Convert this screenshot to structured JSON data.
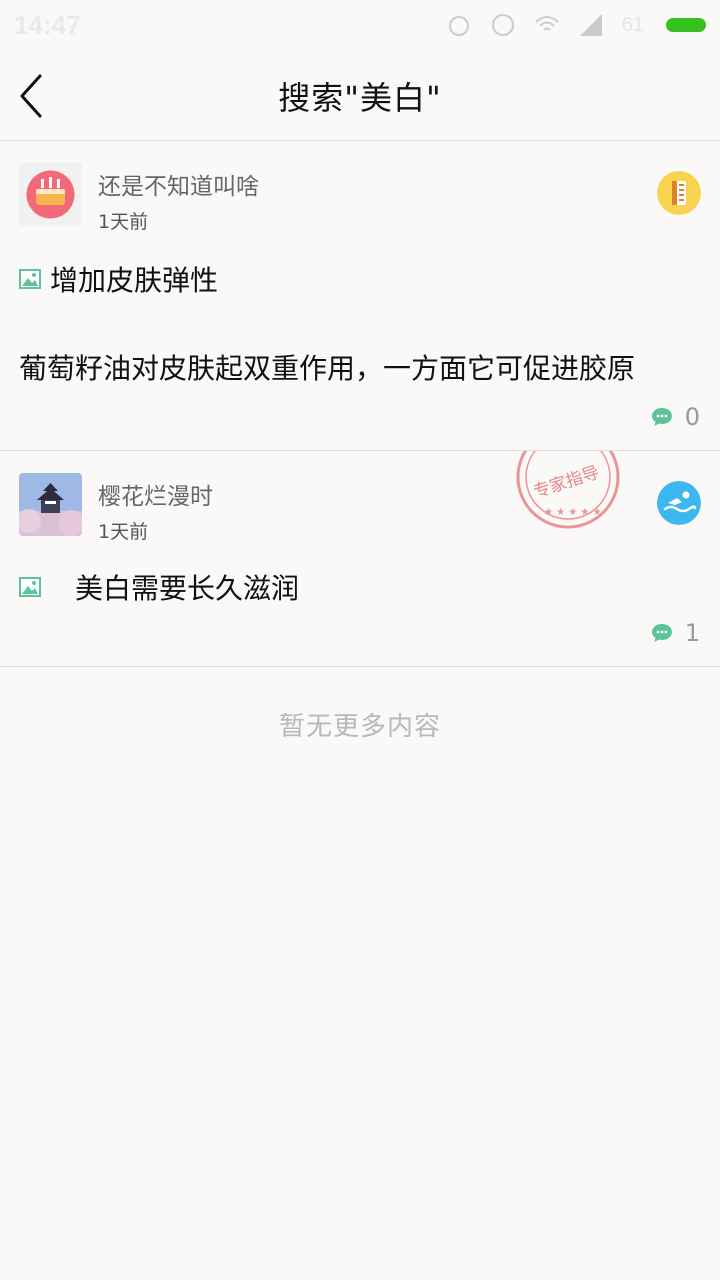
{
  "status_bar": {
    "time": "14:47",
    "battery_text": "61",
    "battery_color": "#35c21e"
  },
  "header": {
    "title": "搜索\"美白\"",
    "back_icon": "chevron-left-icon"
  },
  "posts": [
    {
      "username": "还是不知道叫啥",
      "time": "1天前",
      "title": "增加皮肤弹性",
      "excerpt": "葡萄籽油对皮肤起双重作用，一方面它可促进胶原",
      "comment_count": "0",
      "badge_icon": "ruler-badge-icon",
      "badge_color": "#f8d34f"
    },
    {
      "username": "樱花烂漫时",
      "time": "1天前",
      "title": "美白需要长久滋润",
      "comment_count": "1",
      "badge_icon": "swimmer-badge-icon",
      "badge_color": "#3db7ef",
      "stamp_text": "专家指导",
      "stamp_color": "#e77b7b"
    }
  ],
  "footer": {
    "no_more_text": "暂无更多内容"
  },
  "colors": {
    "accent_green": "#5cc49a",
    "background": "#faf9f7"
  }
}
